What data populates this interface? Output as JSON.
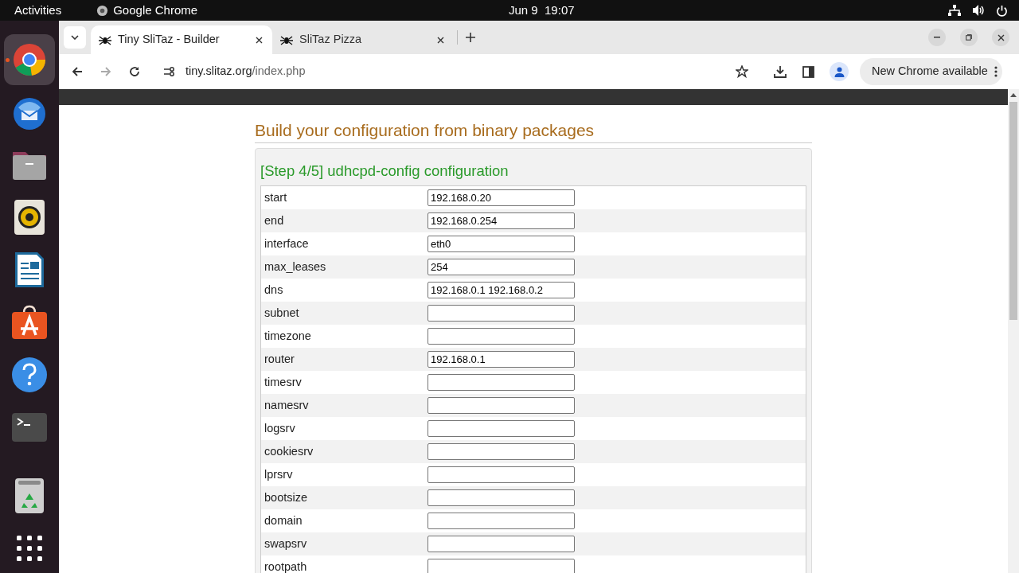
{
  "topbar": {
    "activities": "Activities",
    "app": "Google Chrome",
    "clock": "Jun 9  19:07"
  },
  "dock": [
    {
      "kind": "chrome",
      "selected": true,
      "running": true
    },
    {
      "kind": "mail",
      "selected": false,
      "running": false
    },
    {
      "kind": "files",
      "selected": false,
      "running": false
    },
    {
      "kind": "speaker",
      "selected": false,
      "running": false
    },
    {
      "kind": "writer",
      "selected": false,
      "running": false
    },
    {
      "kind": "store",
      "selected": false,
      "running": false
    },
    {
      "kind": "help",
      "selected": false,
      "running": false
    },
    {
      "kind": "terminal",
      "selected": false,
      "running": false
    },
    {
      "kind": "separator"
    },
    {
      "kind": "trash",
      "selected": false,
      "running": false
    },
    {
      "kind": "grid",
      "selected": false,
      "running": false
    }
  ],
  "tabs": [
    {
      "title": "Tiny SliTaz - Builder",
      "selected": true
    },
    {
      "title": "SliTaz Pizza",
      "selected": false
    }
  ],
  "address": {
    "host": "tiny.slitaz.org",
    "path": "/index.php"
  },
  "update_button": "New Chrome available",
  "page": {
    "heading": "Build your configuration from binary packages",
    "step_title": "[Step 4/5] udhcpd-config configuration",
    "fields": [
      {
        "label": "start",
        "value": "192.168.0.20"
      },
      {
        "label": "end",
        "value": "192.168.0.254"
      },
      {
        "label": "interface",
        "value": "eth0"
      },
      {
        "label": "max_leases",
        "value": "254"
      },
      {
        "label": "dns",
        "value": "192.168.0.1 192.168.0.2"
      },
      {
        "label": "subnet"
      },
      {
        "label": "timezone"
      },
      {
        "label": "router",
        "value": "192.168.0.1"
      },
      {
        "label": "timesrv"
      },
      {
        "label": "namesrv"
      },
      {
        "label": "logsrv"
      },
      {
        "label": "cookiesrv"
      },
      {
        "label": "lprsrv"
      },
      {
        "label": "bootsize"
      },
      {
        "label": "domain"
      },
      {
        "label": "swapsrv"
      },
      {
        "label": "rootpath"
      }
    ]
  }
}
